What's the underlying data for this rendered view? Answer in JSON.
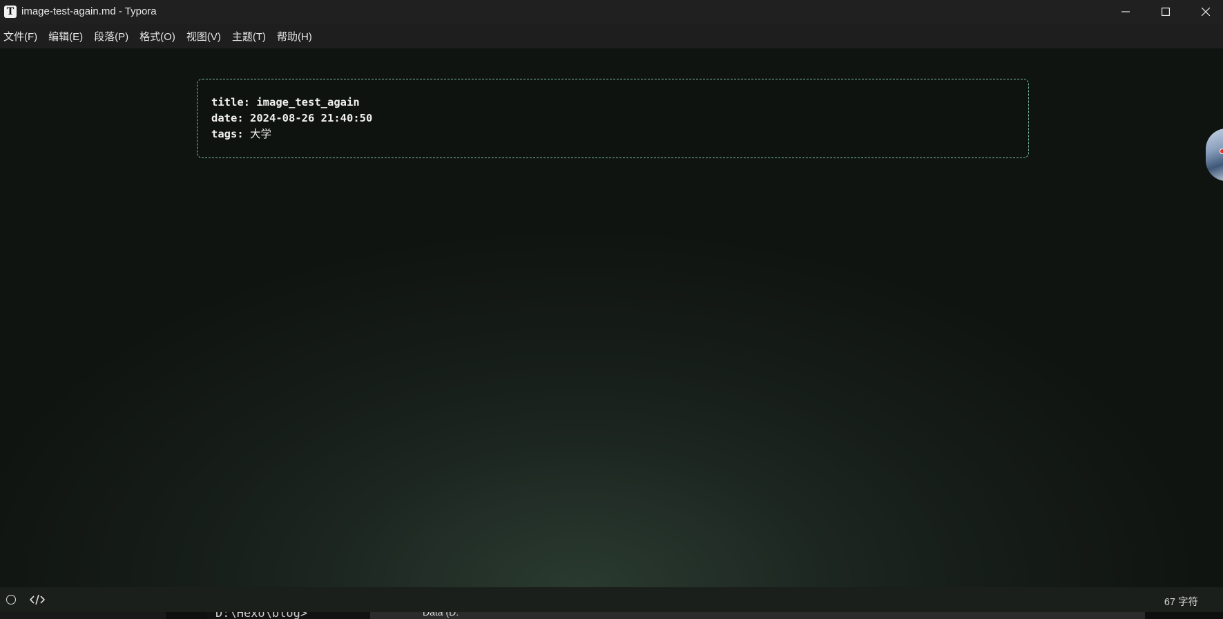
{
  "window": {
    "app_icon_letter": "T",
    "title": "image-test-again.md - Typora"
  },
  "menu": {
    "items": [
      "文件(F)",
      "编辑(E)",
      "段落(P)",
      "格式(O)",
      "视图(V)",
      "主题(T)",
      "帮助(H)"
    ]
  },
  "front_matter": {
    "title_key": "title:",
    "title_value": "image_test_again",
    "date_key": "date:",
    "date_value": "2024-08-26 21:40:50",
    "tags_key": "tags:",
    "tags_value": "大学"
  },
  "statusbar": {
    "word_count": "67 字符"
  },
  "background": {
    "terminal_text": "D:\\Hexo\\blog>",
    "explorer_text": "Data (D:"
  },
  "colors": {
    "frontmatter_border": "#7ec6a8",
    "widget_dot": "#e0302a"
  }
}
